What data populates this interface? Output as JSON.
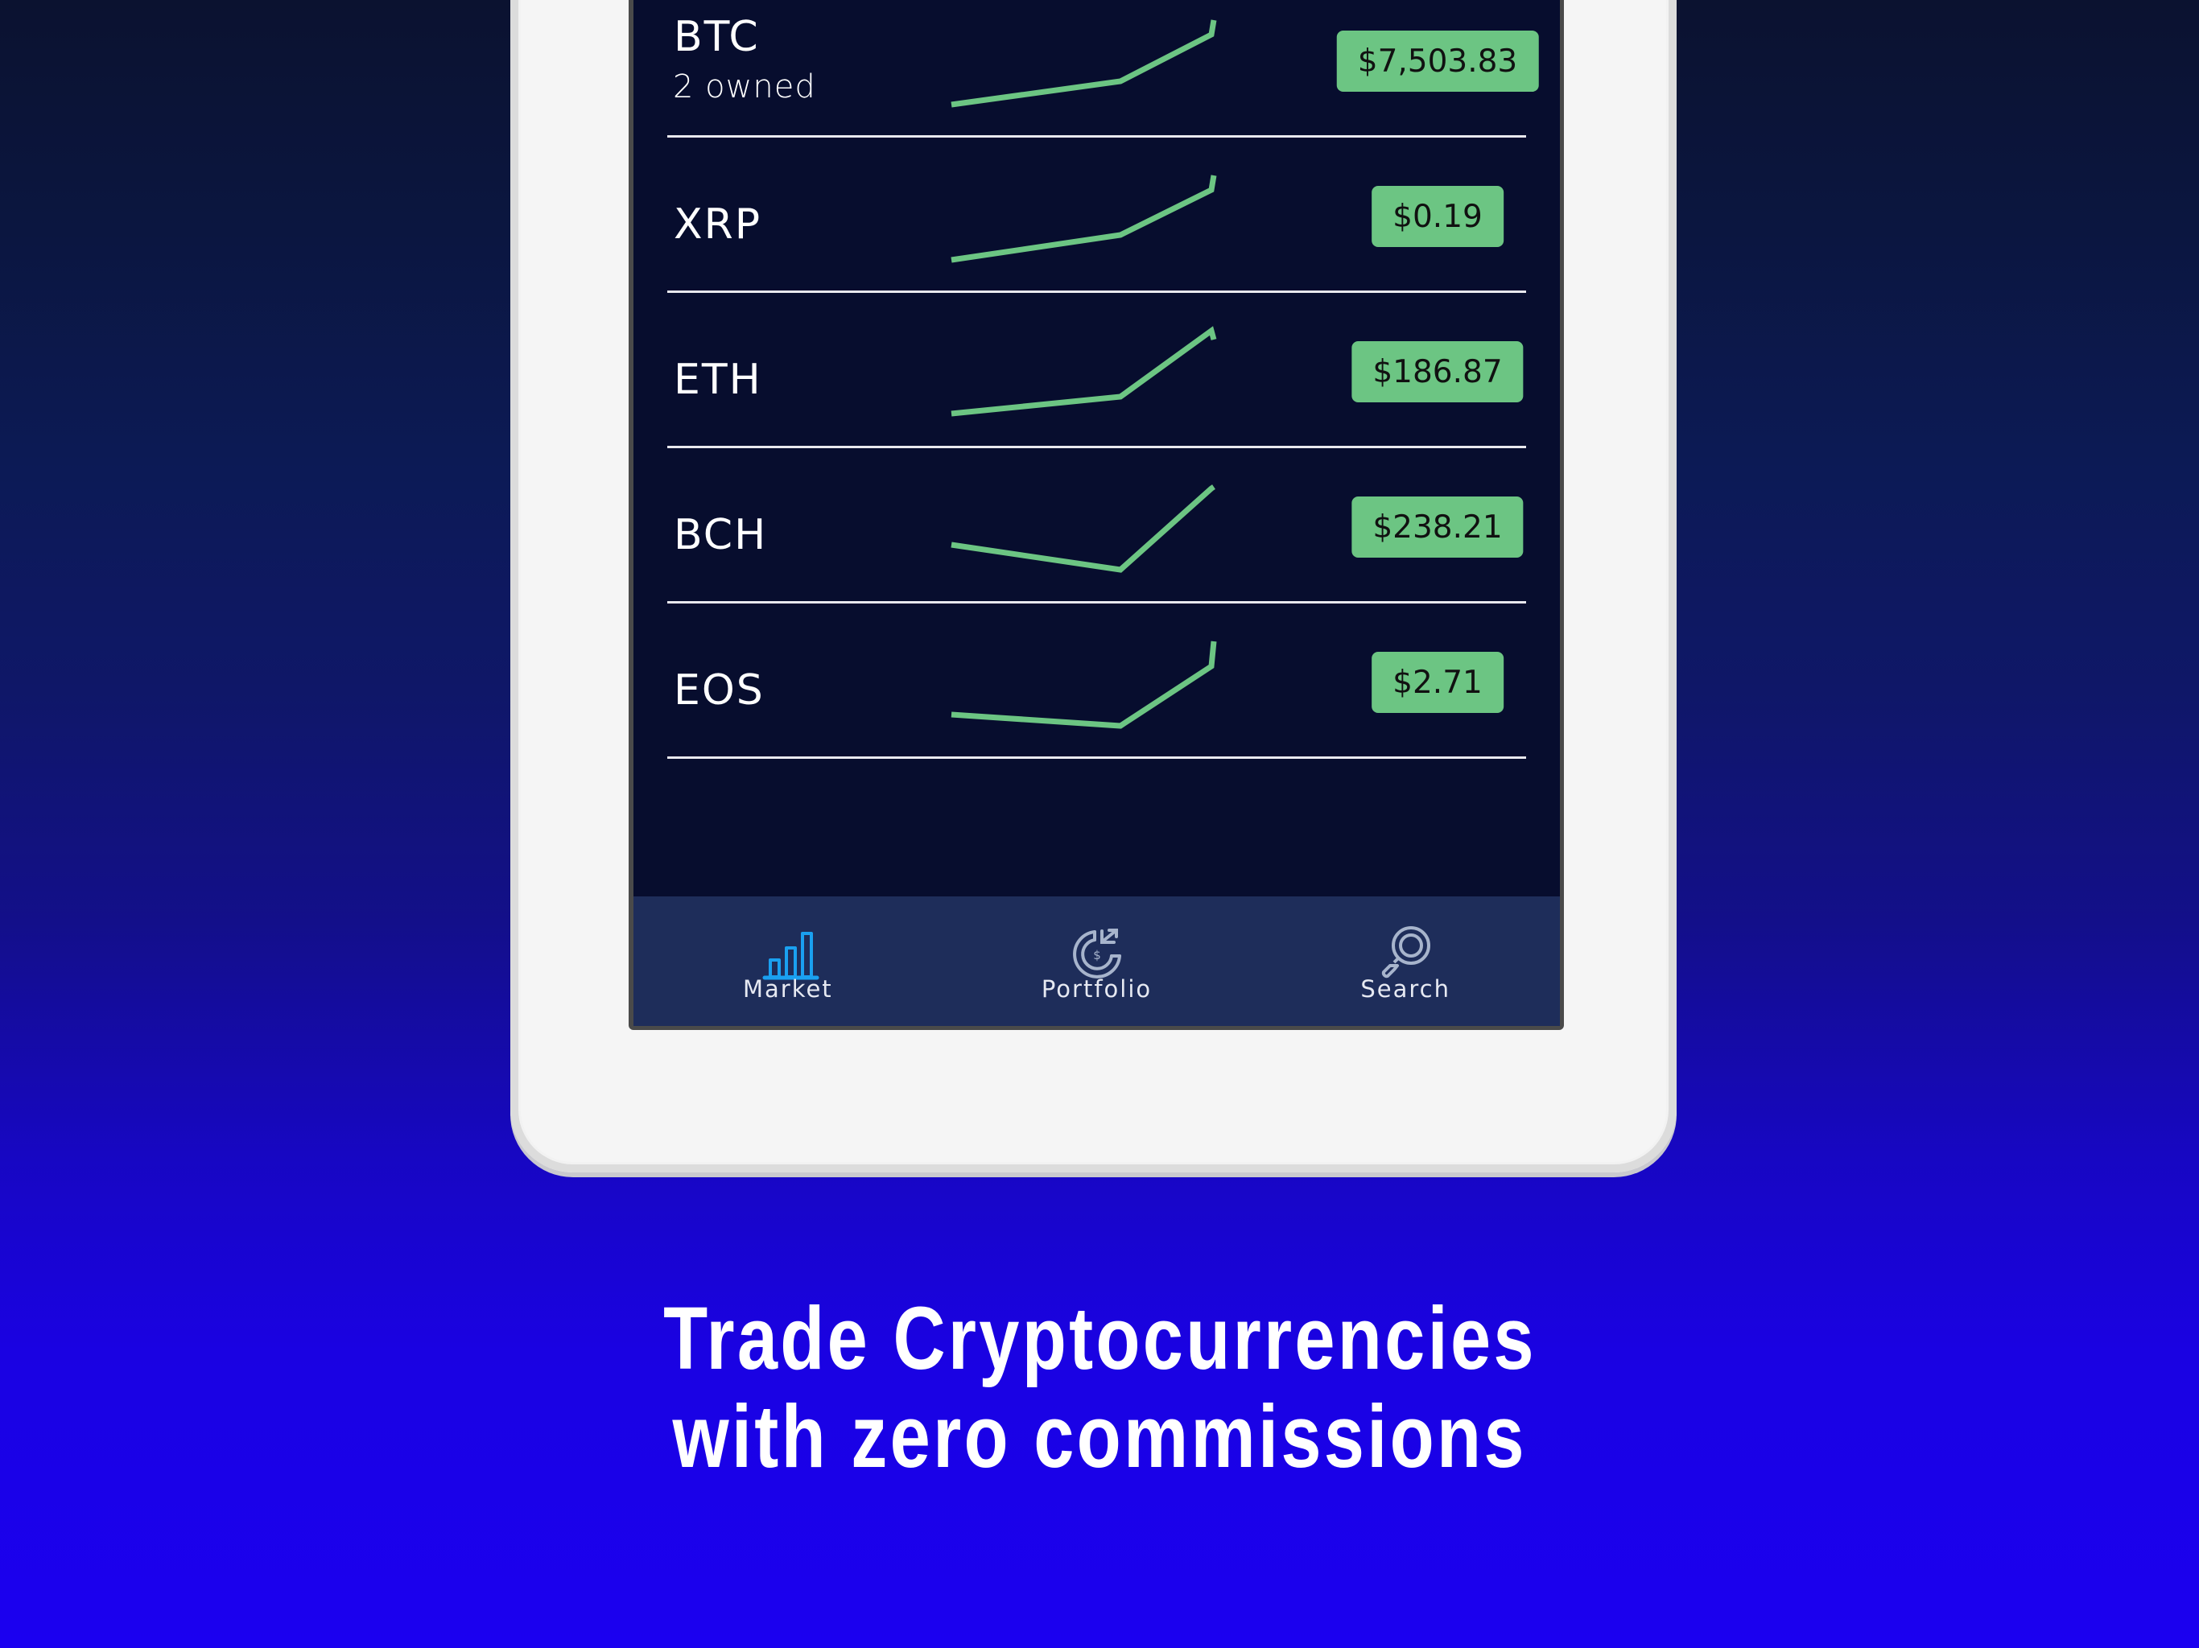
{
  "colors": {
    "screen_bg": "#070d2e",
    "nav_bg": "#1e2d5a",
    "price_pill": "#6cc583",
    "sparkline": "#6cc583",
    "nav_active": "#1aa0f0",
    "nav_inactive": "#a7b4cc"
  },
  "market": {
    "coins": [
      {
        "symbol": "BTC",
        "owned": "2 owned",
        "price": "$7,503.83",
        "trend": [
          48,
          77,
          135,
          153
        ]
      },
      {
        "symbol": "XRP",
        "owned": null,
        "price": "$0.19",
        "trend": [
          48,
          79,
          135,
          153
        ]
      },
      {
        "symbol": "ETH",
        "owned": null,
        "price": "$186.87",
        "trend": [
          50,
          71,
          153,
          142
        ]
      },
      {
        "symbol": "BCH",
        "owned": null,
        "price": "$238.21",
        "trend": [
          80,
          49,
          150,
          152
        ]
      },
      {
        "symbol": "EOS",
        "owned": null,
        "price": "$2.71",
        "trend": [
          62,
          48,
          122,
          153
        ]
      }
    ]
  },
  "nav": {
    "items": [
      {
        "label": "Market",
        "icon": "bar-chart-icon",
        "active": true
      },
      {
        "label": "Portfolio",
        "icon": "portfolio-dollar-icon",
        "active": false
      },
      {
        "label": "Search",
        "icon": "search-icon",
        "active": false
      }
    ]
  },
  "headline": {
    "line1": "Trade Cryptocurrencies",
    "line2": "with zero commissions"
  }
}
